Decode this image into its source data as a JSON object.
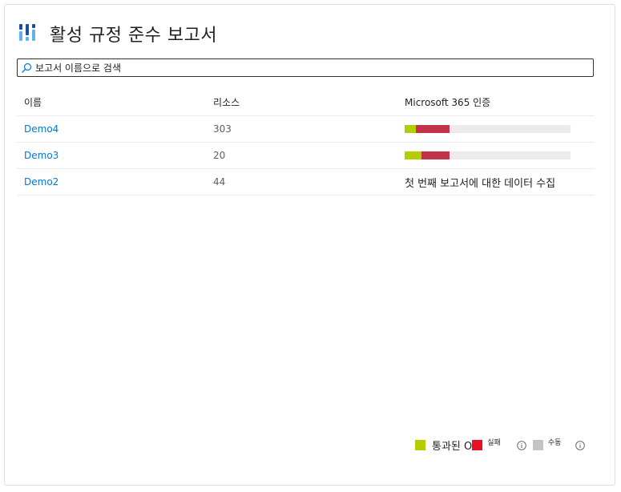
{
  "header": {
    "title": "활성 규정 준수 보고서",
    "logo_icon": "compliance-report-logo-icon"
  },
  "search": {
    "placeholder": "보고서 이름으로 검색",
    "icon": "search-icon"
  },
  "table": {
    "columns": [
      "이름",
      "리소스",
      "Microsoft 365 인증"
    ],
    "rows": [
      {
        "name": "Demo4",
        "resources": "303",
        "passed_fraction": 0.07,
        "failed_fraction": 0.2,
        "status_text": ""
      },
      {
        "name": "Demo3",
        "resources": "20",
        "passed_fraction": 0.1,
        "failed_fraction": 0.17,
        "status_text": ""
      },
      {
        "name": "Demo2",
        "resources": "44",
        "passed_fraction": null,
        "failed_fraction": null,
        "status_text": "첫 번째 보고서에 대한 데이터 수집"
      }
    ]
  },
  "legend": {
    "passed_label": "통과된 O",
    "failed_label": "실패",
    "manual_label": "수동",
    "info_icon": "info-icon"
  },
  "colors": {
    "passed": "#b4cc00",
    "failed_bar": "#c4314b",
    "failed_legend": "#e81123",
    "manual": "#c0c4c8",
    "link": "#0078d4",
    "logo_dark": "#1b4f9c",
    "logo_light": "#5fb3e8"
  }
}
